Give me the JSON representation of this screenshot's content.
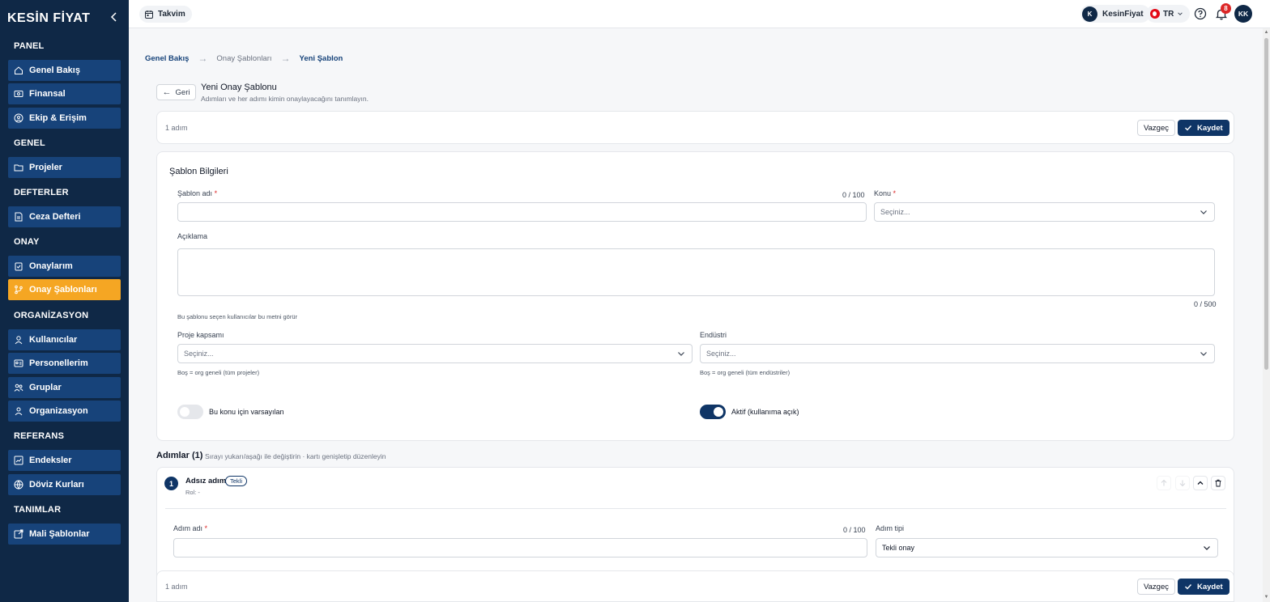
{
  "brand": {
    "logo_text": "KESİN FİYAT"
  },
  "sidebar": {
    "sections": {
      "panel": "PANEL",
      "genel": "GENEL",
      "defterler": "DEFTERLER",
      "onay": "ONAY",
      "organizasyon": "ORGANİZASYON",
      "referans": "REFERANS",
      "tanimlar": "TANIMLAR"
    },
    "items": {
      "genel_bakis": "Genel Bakış",
      "finansal": "Finansal",
      "ekip_erisim": "Ekip & Erişim",
      "projeler": "Projeler",
      "ceza_defteri": "Ceza Defteri",
      "onaylarim": "Onaylarım",
      "onay_sablonlari": "Onay Şablonları",
      "kullanicilar": "Kullanıcılar",
      "personellerim": "Personellerim",
      "gruplar": "Gruplar",
      "organizasyon": "Organizasyon",
      "endeksler": "Endeksler",
      "doviz_kurlari": "Döviz Kurları",
      "mali_sablonlar": "Mali Şablonlar"
    },
    "active_item": "onay_sablonlari",
    "colors": {
      "background": "#0f2846",
      "item": "#17437a",
      "active": "#f5a623"
    }
  },
  "topbar": {
    "calendar_label": "Takvim",
    "user_initial": "K",
    "user_name": "KesinFiyat",
    "language": "TR",
    "notification_count": "8",
    "avatar_initials": "KK"
  },
  "breadcrumb": {
    "home": "Genel Bakış",
    "parent": "Onay Şablonları",
    "current": "Yeni Şablon"
  },
  "header": {
    "back_label": "Geri",
    "title": "Yeni Onay Şablonu",
    "subtitle": "Adımları ve her adımı kimin onaylayacağını tanımlayın."
  },
  "action_bar": {
    "steps_count": "1 adım",
    "cancel_label": "Vazgeç",
    "save_label": "Kaydet"
  },
  "template_info": {
    "heading": "Şablon Bilgileri",
    "name_label": "Şablon adı",
    "name_counter": "0 / 100",
    "name_value": "",
    "topic_label": "Konu",
    "topic_placeholder": "Seçiniz...",
    "description_label": "Açıklama",
    "description_counter": "0 / 500",
    "description_hint": "Bu şablonu seçen kullanıcılar bu metni görür",
    "scope_label": "Proje kapsamı",
    "scope_placeholder": "Seçiniz...",
    "scope_hint": "Boş = org geneli (tüm projeler)",
    "industry_label": "Endüstri",
    "industry_placeholder": "Seçiniz...",
    "industry_hint": "Boş = org geneli (tüm endüstriler)",
    "default_toggle_label": "Bu konu için varsayılan",
    "default_toggle_on": false,
    "active_toggle_label": "Aktif (kullanıma açık)",
    "active_toggle_on": true
  },
  "steps": {
    "heading": "Adımlar (1)",
    "hint": "Sırayı yukarı/aşağı ile değiştirin · kartı genişletip düzenleyin",
    "items": [
      {
        "number": "1",
        "name": "Adsız adım",
        "tag": "Tekli",
        "role": "Rol: -",
        "name_label": "Adım adı",
        "name_counter": "0 / 100",
        "type_label": "Adım tipi",
        "type_value": "Tekli onay"
      }
    ]
  },
  "bottom_bar": {
    "steps_count": "1 adım",
    "cancel_label": "Vazgeç",
    "save_label": "Kaydet"
  }
}
